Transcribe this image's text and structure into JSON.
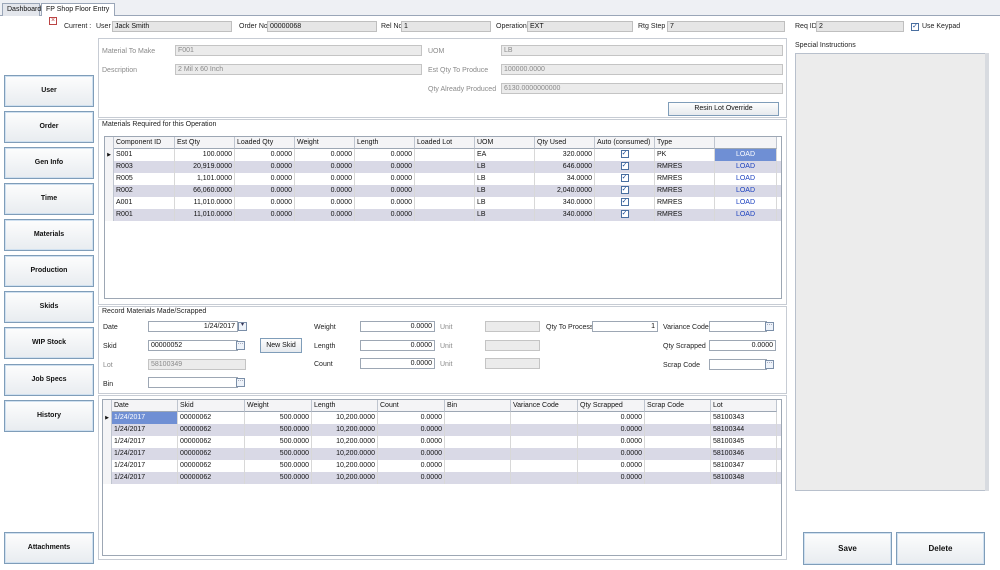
{
  "tabs": [
    {
      "label": "Dashboard"
    },
    {
      "label": "FP Shop Floor Entry"
    }
  ],
  "header": {
    "current_label": "Current :",
    "user_label": "User",
    "user": "Jack Smith",
    "order_label": "Order No",
    "order": "00000068",
    "rel_label": "Rel No",
    "rel": "1",
    "operation_label": "Operation",
    "operation": "EXT",
    "rtg_label": "Rtg Step",
    "rtg": "7",
    "req_label": "Req ID",
    "req": "2",
    "use_keypad": "Use Keypad",
    "use_keypad_checked": true
  },
  "nav": [
    "User",
    "Order",
    "Gen Info",
    "Time",
    "Materials",
    "Production",
    "Skids",
    "WIP Stock",
    "Job Specs",
    "History",
    "Attachments"
  ],
  "material": {
    "make_label": "Material To Make",
    "make": "F001",
    "desc_label": "Description",
    "desc": "2 Mil x 60 Inch",
    "uom_label": "UOM",
    "uom": "LB",
    "est_label": "Est Qty To Produce",
    "est": "100000.0000",
    "already_label": "Qty Already Produced",
    "already": "6130.0000000000",
    "resin_btn": "Resin Lot Override"
  },
  "special_label": "Special Instructions",
  "materials_req": {
    "title": "Materials Required for this Operation",
    "columns": [
      "Component ID",
      "Est Qty",
      "Loaded Qty",
      "Weight",
      "Length",
      "Loaded Lot",
      "UOM",
      "Qty Used",
      "Auto (consumed)",
      "Type",
      ""
    ],
    "rows": [
      [
        "S001",
        "100.0000",
        "0.0000",
        "0.0000",
        "0.0000",
        "",
        "EA",
        "320.0000",
        "✓",
        "PK",
        "LOAD"
      ],
      [
        "R003",
        "20,919.0000",
        "0.0000",
        "0.0000",
        "0.0000",
        "",
        "LB",
        "646.0000",
        "✓",
        "RMRES",
        "LOAD"
      ],
      [
        "R005",
        "1,101.0000",
        "0.0000",
        "0.0000",
        "0.0000",
        "",
        "LB",
        "34.0000",
        "✓",
        "RMRES",
        "LOAD"
      ],
      [
        "R002",
        "66,060.0000",
        "0.0000",
        "0.0000",
        "0.0000",
        "",
        "LB",
        "2,040.0000",
        "✓",
        "RMRES",
        "LOAD"
      ],
      [
        "A001",
        "11,010.0000",
        "0.0000",
        "0.0000",
        "0.0000",
        "",
        "LB",
        "340.0000",
        "✓",
        "RMRES",
        "LOAD"
      ],
      [
        "R001",
        "11,010.0000",
        "0.0000",
        "0.0000",
        "0.0000",
        "",
        "LB",
        "340.0000",
        "✓",
        "RMRES",
        "LOAD"
      ]
    ]
  },
  "record": {
    "title": "Record Materials Made/Scrapped",
    "date_label": "Date",
    "date": "1/24/2017",
    "skid_label": "Skid",
    "skid": "00000052",
    "new_skid": "New Skid",
    "lot_label": "Lot",
    "lot": "58100349",
    "bin_label": "Bin",
    "bin": "",
    "weight_label": "Weight",
    "weight": "0.0000",
    "length_label": "Length",
    "length": "0.0000",
    "count_label": "Count",
    "count": "0.0000",
    "unit_label": "Unit",
    "qty_process_label": "Qty To Process",
    "qty_process": "1",
    "variance_label": "Variance Code",
    "variance": "",
    "qty_scrapped_label": "Qty Scrapped",
    "qty_scrapped": "0.0000",
    "scrap_label": "Scrap Code",
    "scrap": ""
  },
  "made": {
    "columns": [
      "Date",
      "Skid",
      "Weight",
      "Length",
      "Count",
      "Bin",
      "Variance Code",
      "Qty Scrapped",
      "Scrap Code",
      "Lot"
    ],
    "rows": [
      [
        "1/24/2017",
        "00000062",
        "500.0000",
        "10,200.0000",
        "0.0000",
        "",
        "",
        "0.0000",
        "",
        "58100343"
      ],
      [
        "1/24/2017",
        "00000062",
        "500.0000",
        "10,200.0000",
        "0.0000",
        "",
        "",
        "0.0000",
        "",
        "58100344"
      ],
      [
        "1/24/2017",
        "00000062",
        "500.0000",
        "10,200.0000",
        "0.0000",
        "",
        "",
        "0.0000",
        "",
        "58100345"
      ],
      [
        "1/24/2017",
        "00000062",
        "500.0000",
        "10,200.0000",
        "0.0000",
        "",
        "",
        "0.0000",
        "",
        "58100346"
      ],
      [
        "1/24/2017",
        "00000062",
        "500.0000",
        "10,200.0000",
        "0.0000",
        "",
        "",
        "0.0000",
        "",
        "58100347"
      ],
      [
        "1/24/2017",
        "00000062",
        "500.0000",
        "10,200.0000",
        "0.0000",
        "",
        "",
        "0.0000",
        "",
        "58100348"
      ]
    ]
  },
  "save": "Save",
  "delete": "Delete"
}
